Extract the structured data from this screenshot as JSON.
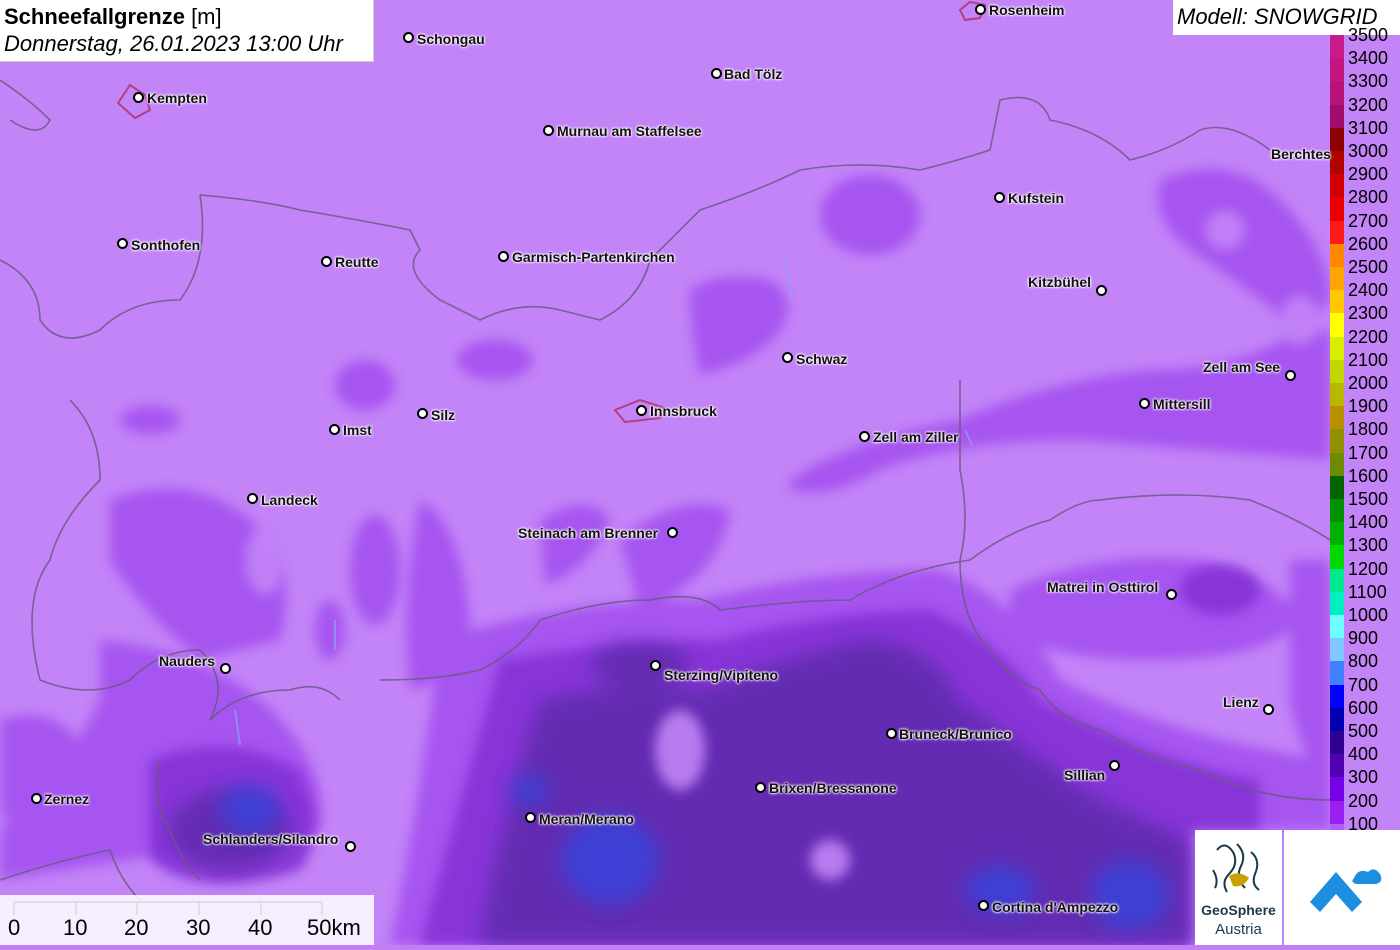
{
  "title": {
    "bold": "Schneefallgrenze",
    "unit": " [m]",
    "date": "Donnerstag, 26.01.2023 13:00 Uhr"
  },
  "model": "Modell: SNOWGRID",
  "legend": [
    {
      "label": "3500",
      "color": "#c71b8a"
    },
    {
      "label": "3400",
      "color": "#c41581"
    },
    {
      "label": "3300",
      "color": "#b8127a"
    },
    {
      "label": "3200",
      "color": "#a00d6d"
    },
    {
      "label": "3100",
      "color": "#8e0000"
    },
    {
      "label": "3000",
      "color": "#b00000"
    },
    {
      "label": "2900",
      "color": "#d00000"
    },
    {
      "label": "2800",
      "color": "#e80000"
    },
    {
      "label": "2700",
      "color": "#ff1a1a"
    },
    {
      "label": "2600",
      "color": "#ff8800"
    },
    {
      "label": "2500",
      "color": "#ffa500"
    },
    {
      "label": "2400",
      "color": "#ffc800"
    },
    {
      "label": "2300",
      "color": "#ffff00"
    },
    {
      "label": "2200",
      "color": "#d8f000"
    },
    {
      "label": "2100",
      "color": "#c0d800"
    },
    {
      "label": "2000",
      "color": "#b8b800"
    },
    {
      "label": "1900",
      "color": "#b89000"
    },
    {
      "label": "1800",
      "color": "#909000"
    },
    {
      "label": "1700",
      "color": "#6e8a00"
    },
    {
      "label": "1600",
      "color": "#006400"
    },
    {
      "label": "1500",
      "color": "#009000"
    },
    {
      "label": "1400",
      "color": "#00b000"
    },
    {
      "label": "1300",
      "color": "#00d800"
    },
    {
      "label": "1200",
      "color": "#00e890"
    },
    {
      "label": "1100",
      "color": "#00f0c0"
    },
    {
      "label": "1000",
      "color": "#70ffff"
    },
    {
      "label": "900",
      "color": "#80c8ff"
    },
    {
      "label": "800",
      "color": "#4080ff"
    },
    {
      "label": "700",
      "color": "#0000ff"
    },
    {
      "label": "600",
      "color": "#0000b0"
    },
    {
      "label": "500",
      "color": "#300090"
    },
    {
      "label": "400",
      "color": "#5000b0"
    },
    {
      "label": "300",
      "color": "#7800e8"
    },
    {
      "label": "200",
      "color": "#9a20f0"
    },
    {
      "label": "100",
      "color": "#b060f8"
    }
  ],
  "cities": {
    "rosenheim": "Rosenheim",
    "schongau": "Schongau",
    "bad_toelz": "Bad Tölz",
    "kempten": "Kempten",
    "murnau": "Murnau am Staffelsee",
    "berchtesgaden": "Berchtes",
    "kufstein": "Kufstein",
    "sonthofen": "Sonthofen",
    "reutte": "Reutte",
    "garmisch": "Garmisch-Partenkirchen",
    "kitzbuehel": "Kitzbühel",
    "schwaz": "Schwaz",
    "zell_am_see": "Zell am See",
    "mittersill": "Mittersill",
    "silz": "Silz",
    "innsbruck": "Innsbruck",
    "imst": "Imst",
    "zell_am_ziller": "Zell am Ziller",
    "landeck": "Landeck",
    "steinach": "Steinach am Brenner",
    "matrei": "Matrei in Osttirol",
    "nauders": "Nauders",
    "sterzing": "Sterzing/Vipiteno",
    "lienz": "Lienz",
    "bruneck": "Bruneck/Brunico",
    "sillian": "Sillian",
    "brixen": "Brixen/Bressanone",
    "zernez": "Zernez",
    "meran": "Meran/Merano",
    "schlanders": "Schlanders/Silandro",
    "cortina": "Cortina d'Ampezzo"
  },
  "scale": {
    "labels": [
      "0",
      "10",
      "20",
      "30",
      "40",
      "50km"
    ]
  },
  "logos": {
    "geosphere_name": "GeoSphere",
    "geosphere_sub": "Austria"
  }
}
